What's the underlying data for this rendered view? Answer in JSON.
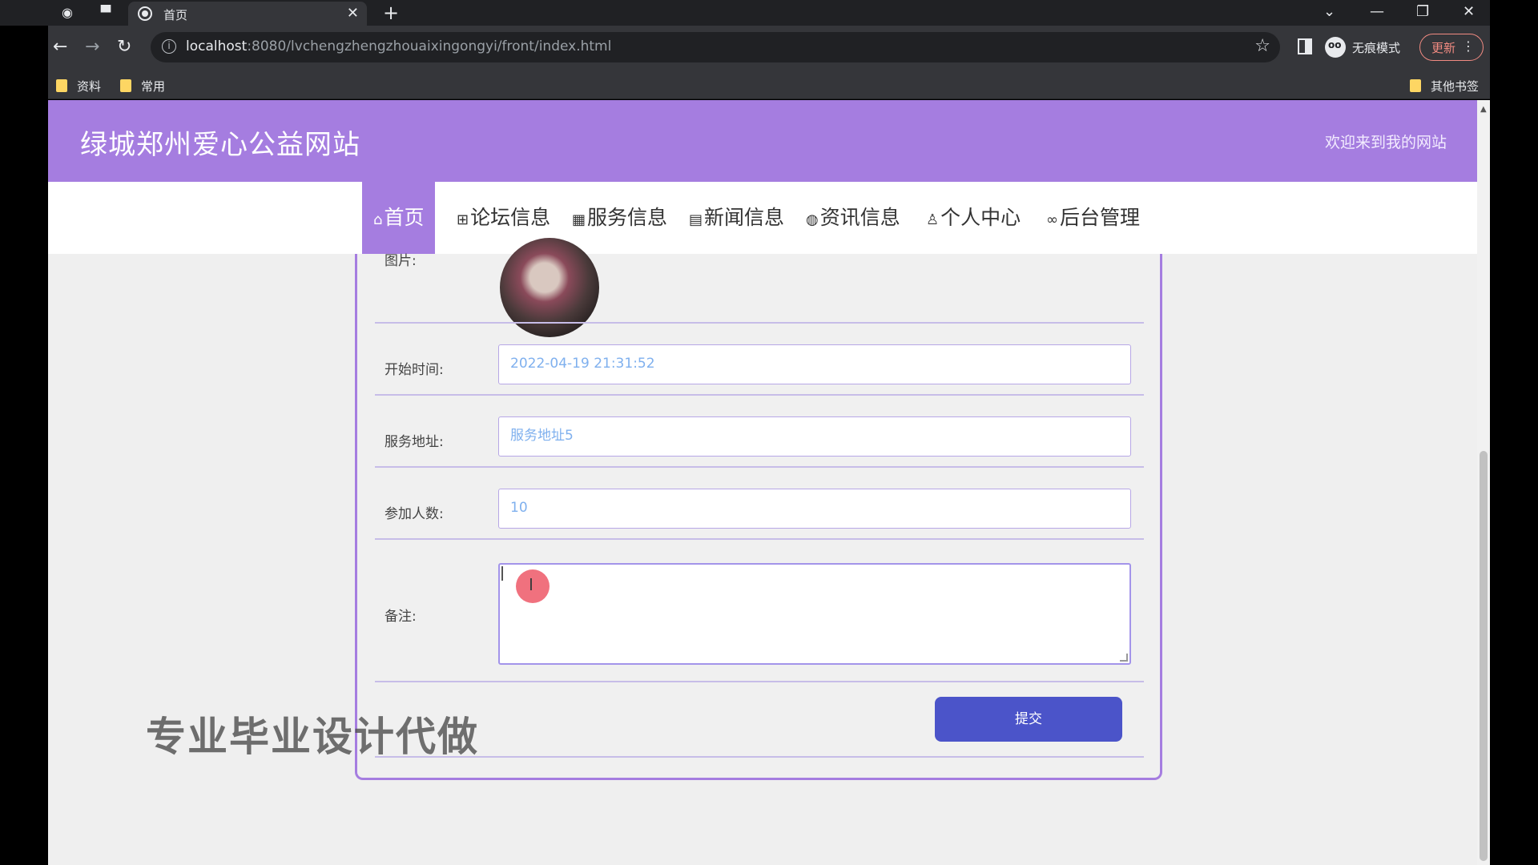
{
  "browser": {
    "tab_title": "首页",
    "url_host": "localhost",
    "url_path": ":8080/lvchengzhengzhouaixingongyi/front/index.html",
    "incognito_label": "无痕模式",
    "update_label": "更新",
    "bookmarks": [
      "资料",
      "常用"
    ],
    "other_bookmarks": "其他书签"
  },
  "site": {
    "title": "绿城郑州爱心公益网站",
    "welcome": "欢迎来到我的网站"
  },
  "nav": {
    "items": [
      {
        "label": "首页",
        "icon": "home-icon"
      },
      {
        "label": "论坛信息",
        "icon": "gift-icon"
      },
      {
        "label": "服务信息",
        "icon": "grid-icon"
      },
      {
        "label": "新闻信息",
        "icon": "apps-icon"
      },
      {
        "label": "资讯信息",
        "icon": "globe-icon"
      },
      {
        "label": "个人中心",
        "icon": "user-icon"
      },
      {
        "label": "后台管理",
        "icon": "link-icon"
      }
    ],
    "active_index": 0
  },
  "form": {
    "image_label": "图片:",
    "start_time_label": "开始时间:",
    "start_time_value": "2022-04-19 21:31:52",
    "address_label": "服务地址:",
    "address_value": "服务地址5",
    "participants_label": "参加人数:",
    "participants_value": "10",
    "remark_label": "备注:",
    "remark_value": "",
    "submit_label": "提交"
  },
  "watermark": "专业毕业设计代做",
  "colors": {
    "brand": "#a57de0",
    "submit": "#4b54c9",
    "input_text": "#7fb0ee"
  }
}
